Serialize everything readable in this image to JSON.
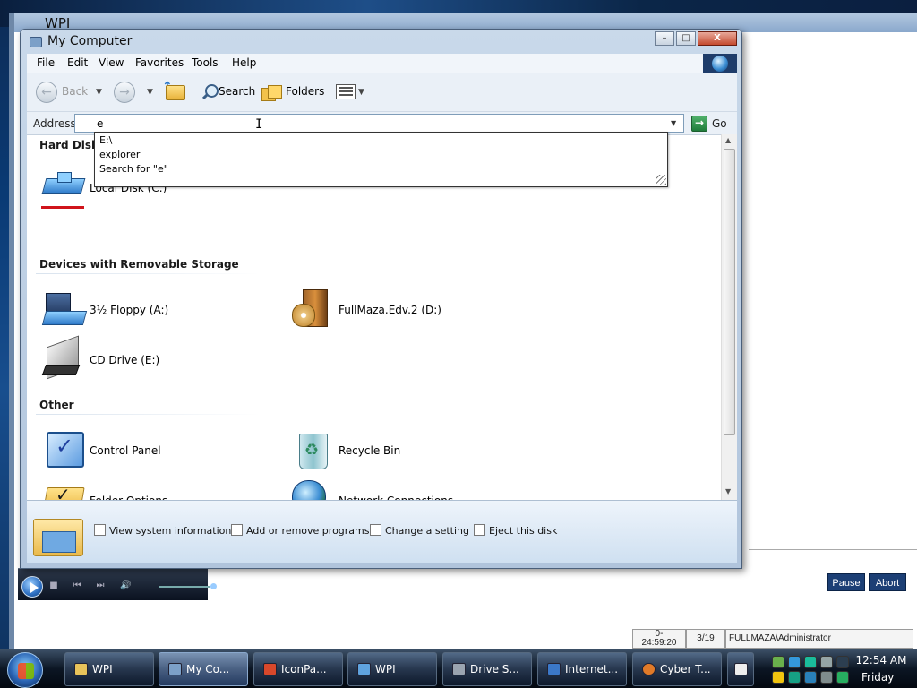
{
  "wpi": {
    "title": "WPI",
    "pause_label": "Pause",
    "abort_label": "Abort",
    "status": {
      "timer_label": "0-",
      "timer_value": "24:59:20",
      "progress": "3/19",
      "user": "FULLMAZA\\Administrator"
    }
  },
  "window": {
    "title": "My Computer",
    "minimize_label": "–",
    "maximize_label": "□",
    "close_label": "X"
  },
  "menu": [
    "File",
    "Edit",
    "View",
    "Favorites",
    "Tools",
    "Help"
  ],
  "toolbar": {
    "back_label": "Back",
    "search_label": "Search",
    "folders_label": "Folders"
  },
  "address": {
    "label": "Address",
    "value": "e",
    "go_label": "Go"
  },
  "autocomplete": [
    "E:\\",
    "explorer",
    "Search for \"e\""
  ],
  "groups": {
    "hard_disk": "Hard Disk Drives",
    "removable": "Devices with Removable Storage",
    "other": "Other"
  },
  "drives": {
    "local_disk": "Local Disk (C:)",
    "floppy": "3½ Floppy (A:)",
    "dvd": "FullMaza.Edv.2 (D:)",
    "cd": "CD Drive (E:)"
  },
  "other_items": {
    "control_panel": "Control Panel",
    "recycle_bin": "Recycle Bin",
    "folder_options": "Folder Options",
    "network": "Network Connections"
  },
  "tasks": [
    "View system information",
    "Add or remove programs",
    "Change a setting",
    "Eject this disk"
  ],
  "taskbar": {
    "buttons": [
      "WPI",
      "My Co...",
      "IconPa...",
      "WPI",
      "Drive S...",
      "Internet...",
      "Cyber T..."
    ],
    "time": "12:54 AM",
    "day": "Friday"
  },
  "colors": {
    "taskbar": "#0c1624",
    "wpi_button": "#1c3f75",
    "disk_usage_bar": "#d0141b"
  }
}
